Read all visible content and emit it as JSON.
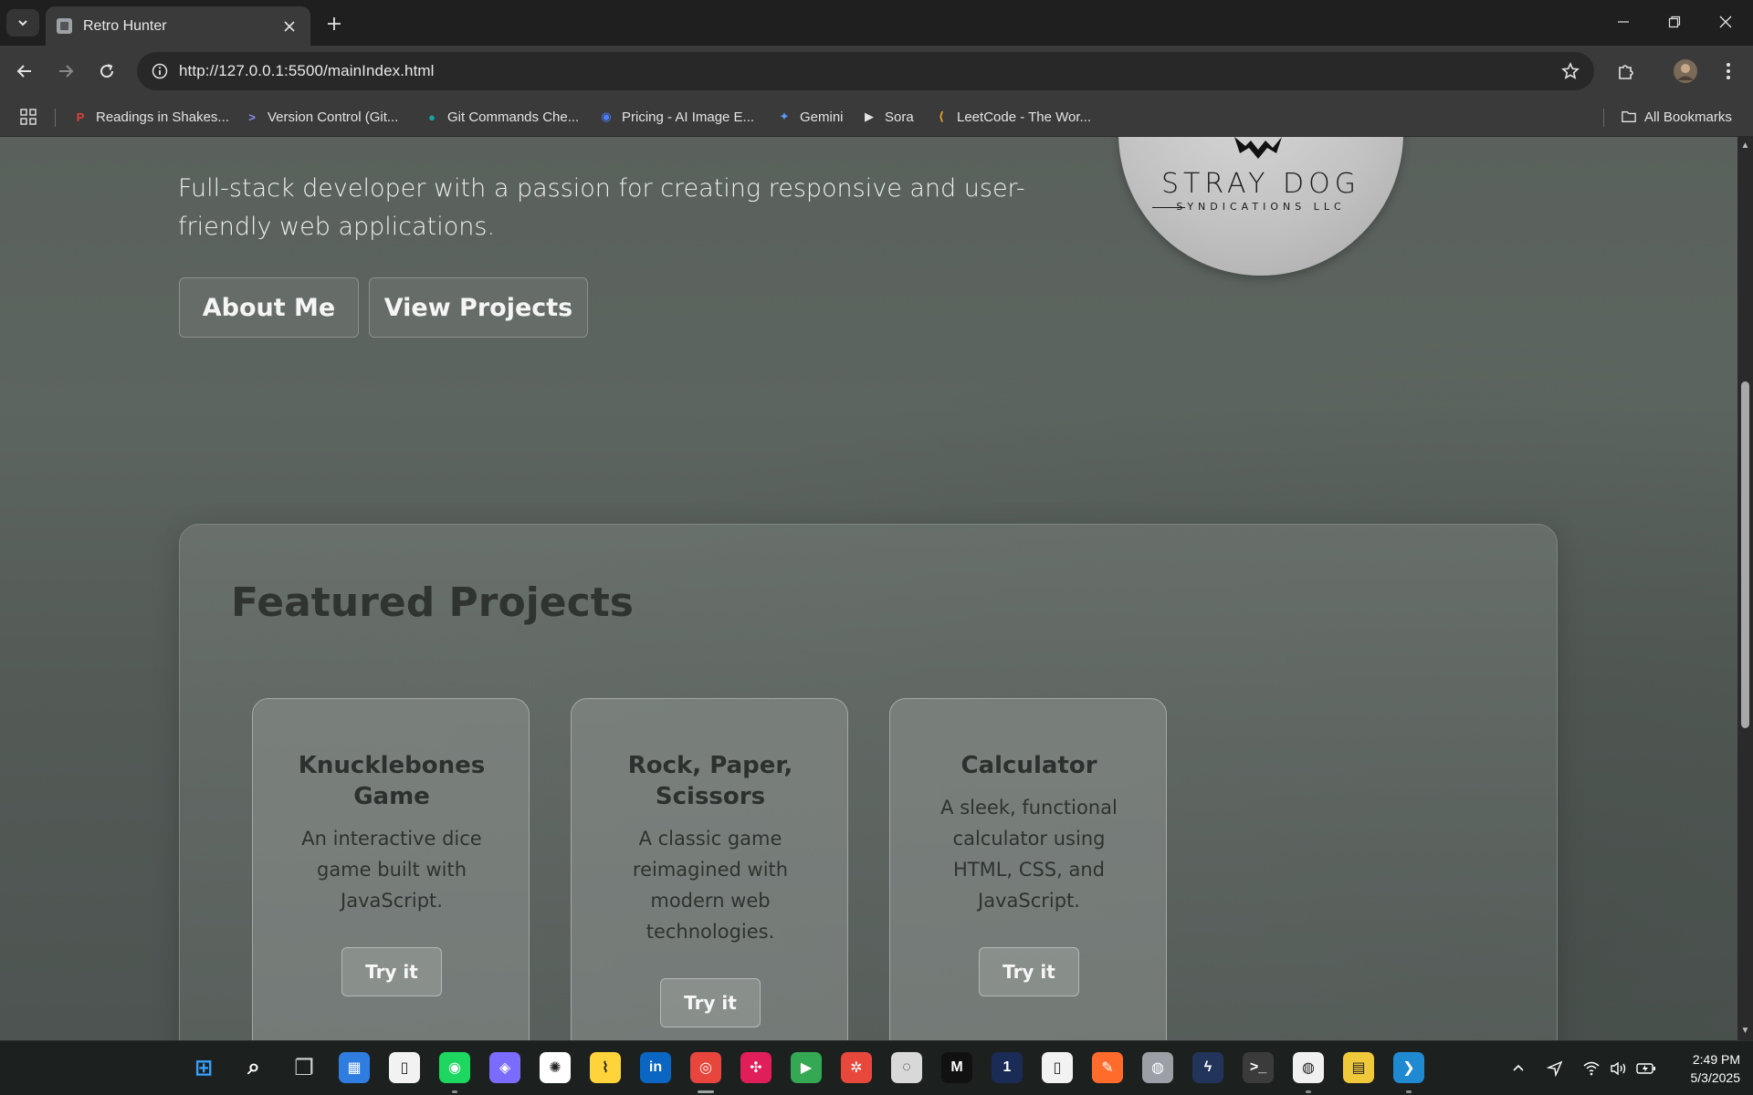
{
  "browser": {
    "tab_title": "Retro Hunter",
    "url": "http://127.0.0.1:5500/mainIndex.html",
    "bookmarks": [
      {
        "label": "Readings in Shakes...",
        "icon": "P",
        "color": "#e0413a"
      },
      {
        "label": "Version Control (Git...",
        "icon": ">",
        "color": "#8f8cf5"
      },
      {
        "label": "Git Commands Che...",
        "icon": "●",
        "color": "#1aa3a3"
      },
      {
        "label": "Pricing - AI Image E...",
        "icon": "◉",
        "color": "#4a7cff"
      },
      {
        "label": "Gemini",
        "icon": "✦",
        "color": "#5b9bff"
      },
      {
        "label": "Sora",
        "icon": "▶",
        "color": "#e3e3e3"
      },
      {
        "label": "LeetCode - The Wor...",
        "icon": "⟨",
        "color": "#f0a531"
      }
    ],
    "all_bookmarks": "All Bookmarks"
  },
  "page": {
    "hero_text": "Full-stack developer with a passion for creating responsive and user-friendly web applications.",
    "about_button": "About Me",
    "projects_button": "View Projects",
    "logo_title": "STRAY DOG",
    "logo_subtitle": "SYNDICATIONS LLC",
    "featured_title": "Featured Projects",
    "projects": [
      {
        "title": "Knucklebones Game",
        "description": "An interactive dice game built with JavaScript.",
        "button": "Try it"
      },
      {
        "title": "Rock, Paper, Scissors",
        "description": "A classic game reimagined with modern web technologies.",
        "button": "Try it"
      },
      {
        "title": "Calculator",
        "description": "A sleek, functional calculator using HTML, CSS, and JavaScript.",
        "button": "Try it"
      }
    ]
  },
  "taskbar": {
    "apps": [
      {
        "name": "start-icon",
        "glyph": "⊞",
        "color": "#3aa0ff"
      },
      {
        "name": "search-icon",
        "glyph": "⌕",
        "color": "#ffffff"
      },
      {
        "name": "task-view-icon",
        "glyph": "❐",
        "color": "#cfd6d3"
      },
      {
        "name": "calendar-app-icon",
        "glyph": "▦",
        "color": "#2f7de1"
      },
      {
        "name": "file-app-icon",
        "glyph": "▯",
        "color": "#f2f2f2"
      },
      {
        "name": "spotify-icon",
        "glyph": "◉",
        "color": "#1ed760"
      },
      {
        "name": "copilot-icon",
        "glyph": "◈",
        "color": "#7b6cff"
      },
      {
        "name": "chatgpt-icon",
        "glyph": "✺",
        "color": "#ffffff"
      },
      {
        "name": "analytics-app-icon",
        "glyph": "⌇",
        "color": "#ffd43b"
      },
      {
        "name": "linkedin-icon",
        "glyph": "in",
        "color": "#0a66c2"
      },
      {
        "name": "chrome-icon",
        "glyph": "◎",
        "color": "#e8453c"
      },
      {
        "name": "slack-icon",
        "glyph": "✣",
        "color": "#e01e5a"
      },
      {
        "name": "meet-icon",
        "glyph": "▶",
        "color": "#34a853"
      },
      {
        "name": "red-app-icon",
        "glyph": "✲",
        "color": "#e8473c"
      },
      {
        "name": "magnifier-app-icon",
        "glyph": "◌",
        "color": "#d8d8d8"
      },
      {
        "name": "m-app-icon",
        "glyph": "M",
        "color": "#111111"
      },
      {
        "name": "one-app-icon",
        "glyph": "1",
        "color": "#1a2b55"
      },
      {
        "name": "document-app-icon",
        "glyph": "▯",
        "color": "#f2f2f2"
      },
      {
        "name": "orange-app-icon",
        "glyph": "✎",
        "color": "#ff6b2b"
      },
      {
        "name": "github-desktop-icon",
        "glyph": "◍",
        "color": "#9aa0a6"
      },
      {
        "name": "bolt-app-icon",
        "glyph": "ϟ",
        "color": "#22345a"
      },
      {
        "name": "terminal-icon",
        "glyph": ">_",
        "color": "#3b3b3b"
      },
      {
        "name": "github-icon",
        "glyph": "◍",
        "color": "#f0f0f0"
      },
      {
        "name": "python-file-icon",
        "glyph": "▤",
        "color": "#f0c93a"
      },
      {
        "name": "vscode-icon",
        "glyph": "❯",
        "color": "#1f8ad2"
      }
    ],
    "time": "2:49 PM",
    "date": "5/3/2025"
  }
}
